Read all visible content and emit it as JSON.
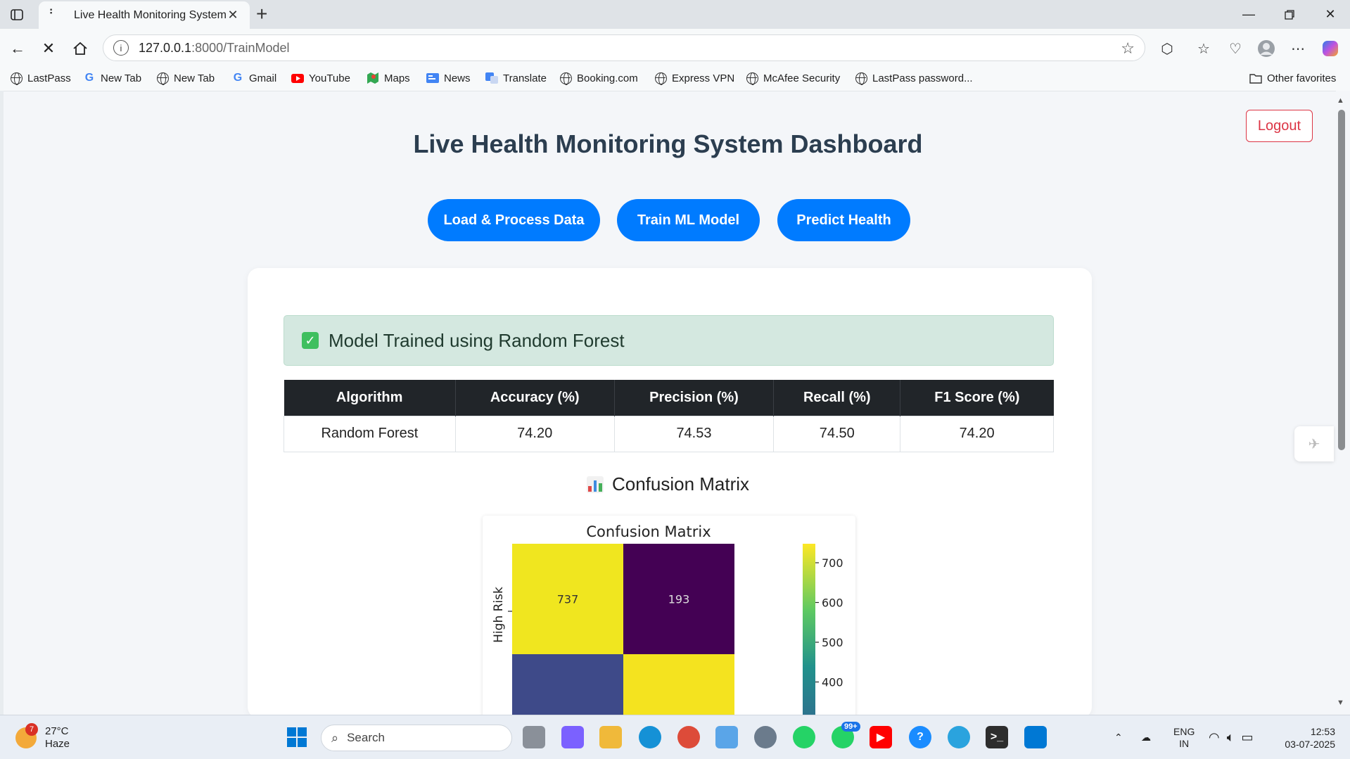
{
  "browser": {
    "tab_title": "Live Health Monitoring System",
    "url_host": "127.0.0.1",
    "url_path": ":8000/TrainModel"
  },
  "bookmarks": [
    {
      "label": "LastPass",
      "icon": "globe-icon"
    },
    {
      "label": "New Tab",
      "icon": "google-icon"
    },
    {
      "label": "New Tab",
      "icon": "globe-icon"
    },
    {
      "label": "Gmail",
      "icon": "google-icon"
    },
    {
      "label": "YouTube",
      "icon": "youtube-icon"
    },
    {
      "label": "Maps",
      "icon": "maps-icon"
    },
    {
      "label": "News",
      "icon": "news-icon"
    },
    {
      "label": "Translate",
      "icon": "translate-icon"
    },
    {
      "label": "Booking.com",
      "icon": "globe-icon"
    },
    {
      "label": "Express VPN",
      "icon": "globe-icon"
    },
    {
      "label": "McAfee Security",
      "icon": "globe-icon"
    },
    {
      "label": "LastPass password...",
      "icon": "globe-icon"
    }
  ],
  "other_favorites": "Other favorites",
  "page": {
    "logout": "Logout",
    "title": "Live Health Monitoring System Dashboard",
    "buttons": {
      "load": "Load & Process Data",
      "train": "Train ML Model",
      "predict": "Predict Health"
    },
    "alert": "Model Trained using Random Forest",
    "table": {
      "headers": [
        "Algorithm",
        "Accuracy (%)",
        "Precision (%)",
        "Recall (%)",
        "F1 Score (%)"
      ],
      "row": [
        "Random Forest",
        "74.20",
        "74.53",
        "74.50",
        "74.20"
      ]
    },
    "cm_heading": "Confusion Matrix"
  },
  "confusion_matrix": {
    "title": "Confusion Matrix",
    "ylabel": "High Risk",
    "cells": [
      {
        "label": "737",
        "color": "#f0e61f",
        "text_color": "#333333"
      },
      {
        "label": "193",
        "color": "#440154",
        "text_color": "#dddddd"
      },
      {
        "label": "",
        "color": "#3e4a89",
        "text_color": "#dddddd"
      },
      {
        "label": "",
        "color": "#f4e31f",
        "text_color": "#333333"
      }
    ],
    "colorbar_ticks": [
      "700",
      "600",
      "500",
      "400"
    ]
  },
  "taskbar": {
    "weather_badge": "7",
    "temperature": "27°C",
    "weather": "Haze",
    "search": "Search",
    "lang1": "ENG",
    "lang2": "IN",
    "time": "12:53",
    "date": "03-07-2025",
    "whatsapp_badge": "99+"
  },
  "colors": {
    "primary": "#007bff",
    "danger": "#dc3545",
    "title": "#2c3e50",
    "table_header": "#212529",
    "alert_bg": "#d4e8e0"
  }
}
